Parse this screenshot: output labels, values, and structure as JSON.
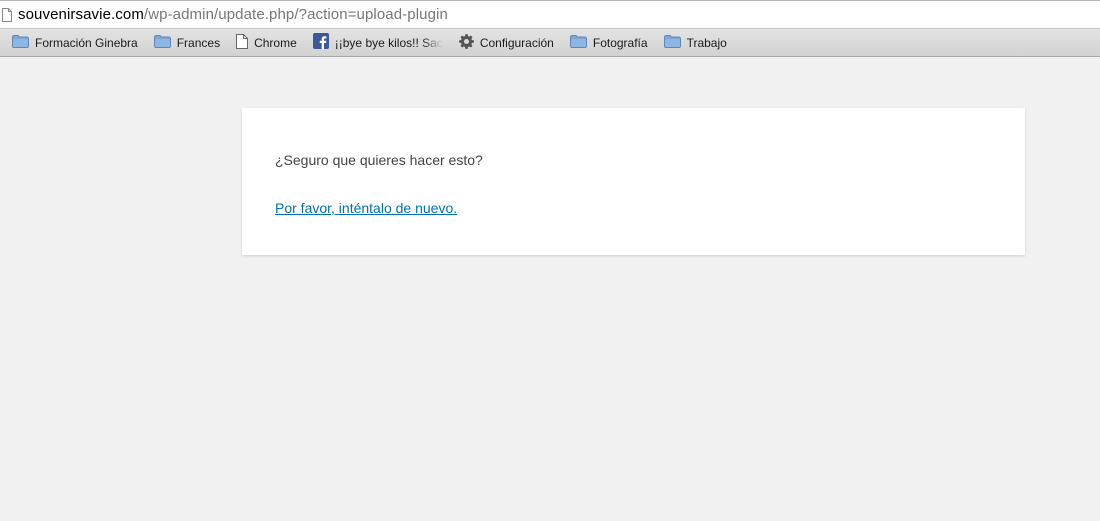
{
  "address_bar": {
    "domain": "souvenirsavie.com",
    "path": "/wp-admin/update.php/?action=upload-plugin"
  },
  "bookmarks": [
    {
      "label": "Formación Ginebra",
      "icon": "folder-icon"
    },
    {
      "label": "Frances",
      "icon": "folder-icon"
    },
    {
      "label": "Chrome",
      "icon": "page-icon"
    },
    {
      "label": "¡¡bye bye kilos!! Sac",
      "icon": "facebook-icon"
    },
    {
      "label": "Configuración",
      "icon": "gear-icon"
    },
    {
      "label": "Fotografía",
      "icon": "folder-icon"
    },
    {
      "label": "Trabajo",
      "icon": "folder-icon"
    }
  ],
  "dialog": {
    "message": "¿Seguro que quieres hacer esto?",
    "retry_link": "Por favor, inténtalo de nuevo."
  },
  "colors": {
    "link": "#0073aa",
    "background": "#f1f1f1",
    "folder": "#7fa7d6",
    "facebook": "#3b5998"
  }
}
